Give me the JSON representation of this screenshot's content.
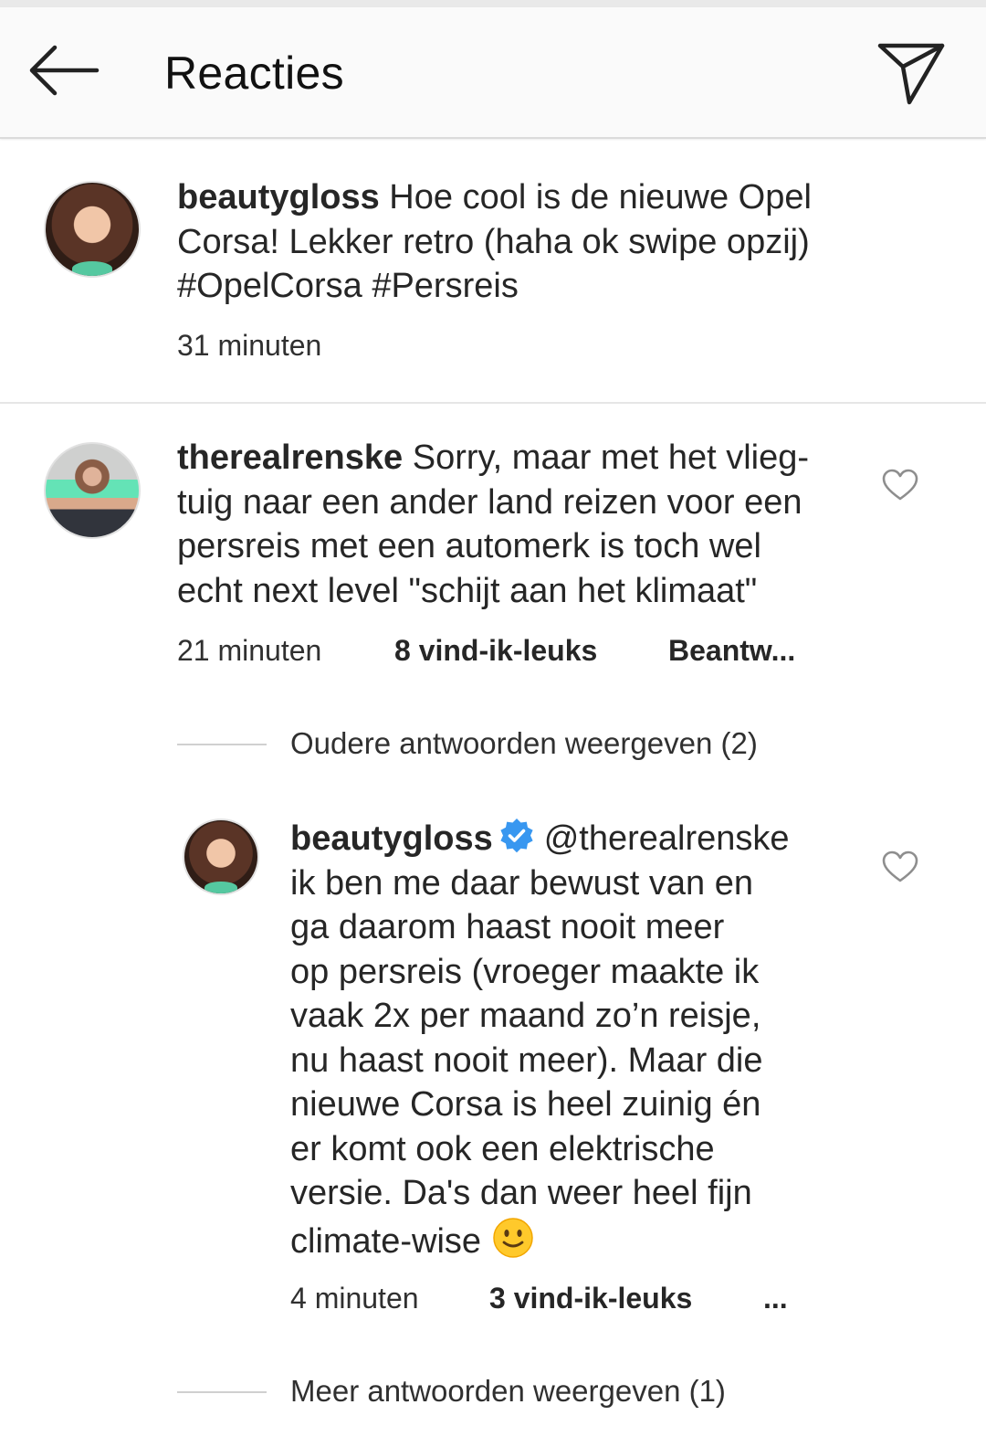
{
  "header": {
    "back_icon": "arrow-left-icon",
    "title": "Reacties",
    "share_icon": "paper-plane-icon"
  },
  "caption": {
    "username": "beautygloss",
    "lines": [
      "Hoe cool is de nieuwe Opel",
      "Corsa! Lekker retro (haha ok swipe opzij)",
      "#OpelCorsa #Persreis"
    ],
    "time": "31 minuten"
  },
  "comment": {
    "username": "therealrenske",
    "lines": [
      "Sorry, maar met het vlieg-",
      "tuig naar een ander land reizen voor een",
      "persreis met een automerk is toch wel",
      "echt next level \"schijt aan het klimaat\""
    ],
    "time": "21 minuten",
    "likes": "8 vind-ik-leuks",
    "reply": "Beantw..."
  },
  "older_replies": {
    "label": "Oudere antwoorden weergeven (2)"
  },
  "reply": {
    "username": "beautygloss",
    "verified_icon": "verified-badge-icon",
    "lines": [
      "@therealrenske",
      "ik ben me daar bewust van en",
      "ga daarom haast nooit meer",
      "op persreis (vroeger maakte ik",
      "vaak 2x per maand zo’n reisje,",
      "nu haast nooit meer). Maar die",
      "nieuwe Corsa is heel zuinig én",
      "er komt ook een elektrische",
      "versie. Da's dan weer heel fijn",
      "climate-wise"
    ],
    "emoji": "slightly-smiling-face-icon",
    "time": "4 minuten",
    "likes": "3 vind-ik-leuks",
    "more": "..."
  },
  "more_replies": {
    "label": "Meer antwoorden weergeven (1)"
  },
  "colors": {
    "verified": "#3897f0",
    "text": "#262626",
    "divider": "#dbdbdb"
  }
}
